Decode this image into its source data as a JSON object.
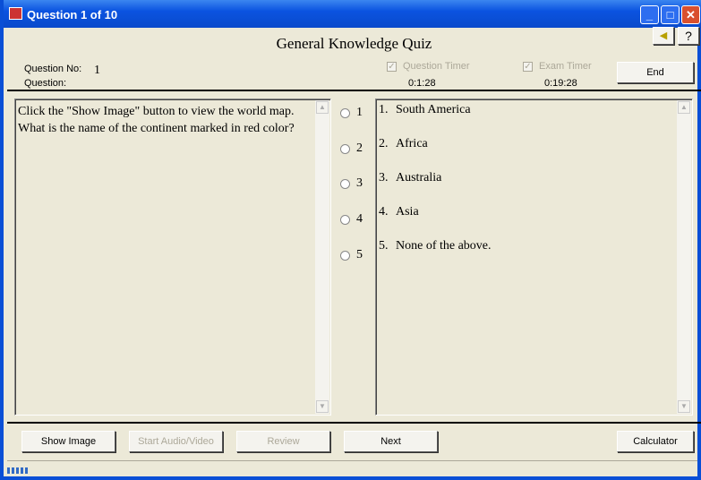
{
  "window": {
    "title": "Question  1 of  10",
    "minimize": "_",
    "maximize": "□",
    "close": "✕"
  },
  "header": {
    "quiz_title": "General Knowledge Quiz",
    "sound_icon": "speaker-icon",
    "help": "?",
    "question_no_label": "Question No:",
    "question_no": "1",
    "question_label": "Question:",
    "question_timer_label": "Question Timer",
    "question_timer_checked": true,
    "question_timer": "0:1:28",
    "exam_timer_label": "Exam Timer",
    "exam_timer_checked": true,
    "exam_timer": "0:19:28",
    "end": "End"
  },
  "question": {
    "lines": [
      "Click the \"Show Image\" button to view the world map.",
      "What is the name of the continent marked in red color?"
    ]
  },
  "options": [
    {
      "n": "1",
      "num": "1.",
      "text": "South America"
    },
    {
      "n": "2",
      "num": "2.",
      "text": "Africa"
    },
    {
      "n": "3",
      "num": "3.",
      "text": "Australia"
    },
    {
      "n": "4",
      "num": "4.",
      "text": "Asia"
    },
    {
      "n": "5",
      "num": "5.",
      "text": "None of the above."
    }
  ],
  "buttons": {
    "show_image": "Show Image",
    "start_av": "Start Audio/Video",
    "review": "Review",
    "next": "Next",
    "calculator": "Calculator"
  },
  "status": {
    "progress_percent": 3,
    "progress_color": "#316ac5"
  }
}
